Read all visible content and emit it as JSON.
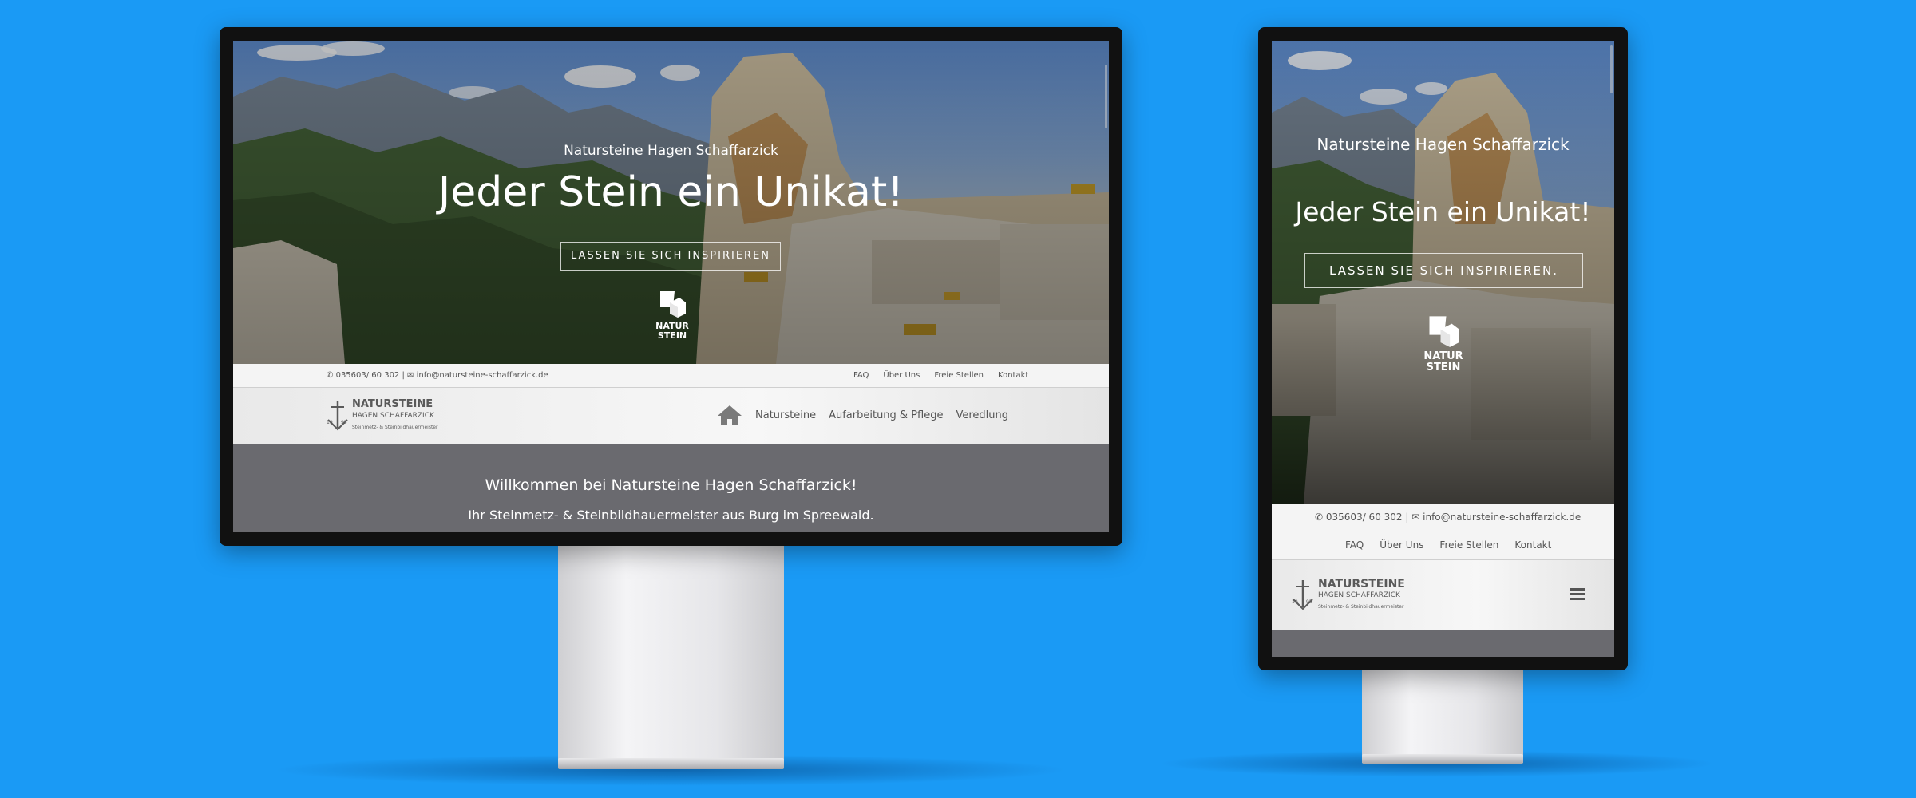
{
  "site": {
    "hero_subtitle": "Natursteine Hagen Schaffarzick",
    "hero_title": "Jeder Stein ein Unikat!",
    "hero_button_desktop": "LASSEN SIE SICH INSPIRIEREN",
    "hero_button_mobile": "LASSEN SIE SICH INSPIRIEREN.",
    "hero_logo": {
      "line1": "NATUR",
      "line2": "STEIN"
    },
    "contact": {
      "phone": "035603/ 60 302",
      "separator": "|",
      "email": "info@natursteine-schaffarzick.de"
    },
    "top_links": [
      "FAQ",
      "Über Uns",
      "Freie Stellen",
      "Kontakt"
    ],
    "logo": {
      "name": "NATURSTEINE",
      "owner": "HAGEN SCHAFFARZICK",
      "tagline": "Steinmetz- & Steinbildhauermeister"
    },
    "nav_links": [
      "Natursteine",
      "Aufarbeitung & Pflege",
      "Veredlung"
    ],
    "welcome_title": "Willkommen bei Natursteine Hagen Schaffarzick!",
    "welcome_text": "Ihr Steinmetz- & Steinbildhauermeister aus Burg im Spreewald."
  },
  "icons": {
    "phone": "phone-icon",
    "email": "envelope-icon",
    "home": "home-icon",
    "menu": "hamburger-menu-icon"
  },
  "colors": {
    "background": "#1a9af5",
    "content_gray": "#6a6a6f",
    "bar_light": "#f4f4f4",
    "text_dark": "#555555"
  }
}
